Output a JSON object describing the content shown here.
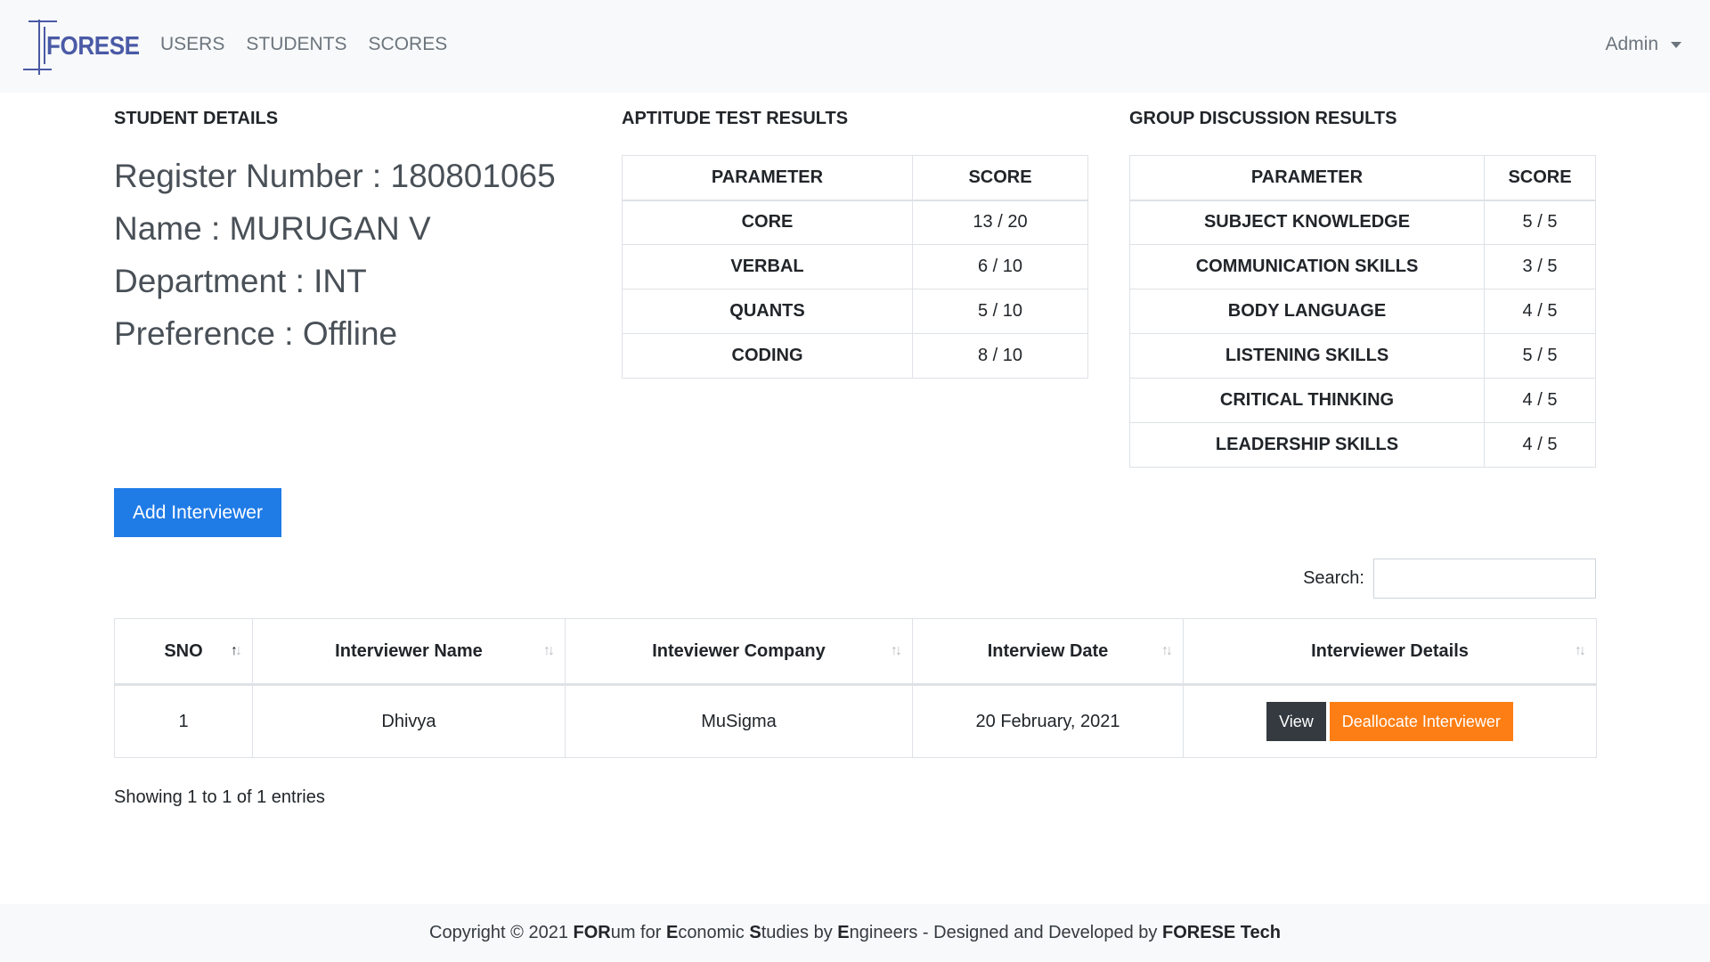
{
  "navbar": {
    "brand": "FORESE",
    "links": [
      "USERS",
      "STUDENTS",
      "SCORES"
    ],
    "user": "Admin"
  },
  "student": {
    "title": "STUDENT DETAILS",
    "register": "Register Number : 180801065",
    "name": "Name : MURUGAN V",
    "department": "Department : INT",
    "preference": "Preference : Offline"
  },
  "aptitude": {
    "title": "APTITUDE TEST RESULTS",
    "headers": [
      "PARAMETER",
      "SCORE"
    ],
    "rows": [
      {
        "param": "CORE",
        "score": "13 / 20"
      },
      {
        "param": "VERBAL",
        "score": "6 / 10"
      },
      {
        "param": "QUANTS",
        "score": "5 / 10"
      },
      {
        "param": "CODING",
        "score": "8 / 10"
      }
    ]
  },
  "gd": {
    "title": "GROUP DISCUSSION RESULTS",
    "headers": [
      "PARAMETER",
      "SCORE"
    ],
    "rows": [
      {
        "param": "SUBJECT KNOWLEDGE",
        "score": "5 / 5"
      },
      {
        "param": "COMMUNICATION SKILLS",
        "score": "3 / 5"
      },
      {
        "param": "BODY LANGUAGE",
        "score": "4 / 5"
      },
      {
        "param": "LISTENING SKILLS",
        "score": "5 / 5"
      },
      {
        "param": "CRITICAL THINKING",
        "score": "4 / 5"
      },
      {
        "param": "LEADERSHIP SKILLS",
        "score": "4 / 5"
      }
    ]
  },
  "add_button": "Add Interviewer",
  "search": {
    "label": "Search:",
    "value": ""
  },
  "interviewers": {
    "headers": [
      "SNO",
      "Interviewer Name",
      "Inteviewer Company",
      "Interview Date",
      "Interviewer Details"
    ],
    "rows": [
      {
        "sno": "1",
        "name": "Dhivya",
        "company": "MuSigma",
        "date": "20 February, 2021",
        "view": "View",
        "deallocate": "Deallocate Interviewer"
      }
    ],
    "info": "Showing 1 to 1 of 1 entries"
  },
  "footer": {
    "prefix": "Copyright © 2021 ",
    "b1": "FOR",
    "t1": "um for ",
    "b2": "E",
    "t2": "conomic ",
    "b3": "S",
    "t3": "tudies by ",
    "b4": "E",
    "t4": "ngineers - Designed and Developed by ",
    "b5": "FORESE Tech"
  },
  "colors": {
    "primary": "#1f7be6",
    "warning": "#fd7e14",
    "dark": "#343a40",
    "brand": "#4a5aa6"
  }
}
